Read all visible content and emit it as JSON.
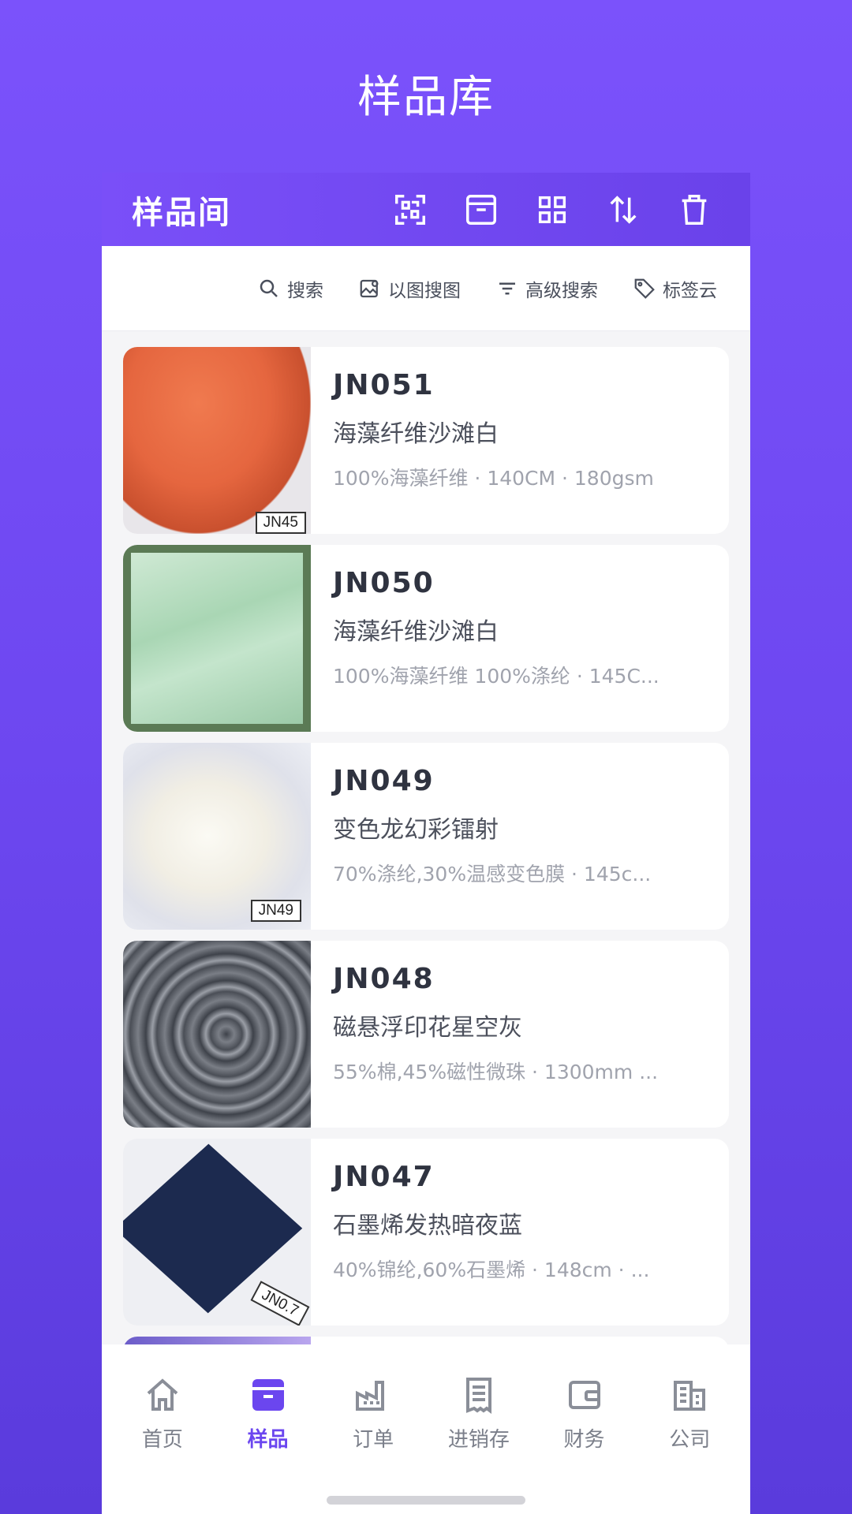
{
  "page_title": "样品库",
  "header": {
    "title": "样品间",
    "icons": [
      "qr-scan-icon",
      "archive-icon",
      "grid-view-icon",
      "sort-icon",
      "delete-icon"
    ]
  },
  "search_bar": {
    "search": "搜索",
    "image_search": "以图搜图",
    "advanced_search": "高级搜索",
    "tag_cloud": "标签云"
  },
  "samples": [
    {
      "code": "JN051",
      "name": "海藻纤维沙滩白",
      "specs": "100%海藻纤维  ·  140CM  ·  180gsm",
      "tag": "JN45",
      "color": "#e5663f"
    },
    {
      "code": "JN050",
      "name": "海藻纤维沙滩白",
      "specs": "100%海藻纤维 100%涤纶  ·  145C...",
      "tag": "",
      "color": "#b8dcc0"
    },
    {
      "code": "JN049",
      "name": "变色龙幻彩镭射",
      "specs": "70%涤纶,30%温感变色膜  ·  145c...",
      "tag": "JN49",
      "color": "#f3f1ea"
    },
    {
      "code": "JN048",
      "name": "磁悬浮印花星空灰",
      "specs": "55%棉,45%磁性微珠  ·  1300mm  ...",
      "tag": "",
      "color": "#5c6068"
    },
    {
      "code": "JN047",
      "name": "石墨烯发热暗夜蓝",
      "specs": "40%锦纶,60%石墨烯  ·  148cm  ·  ...",
      "tag": "JN0.7",
      "color": "#1c2a4f"
    }
  ],
  "tabbar": {
    "items": [
      {
        "label": "首页",
        "icon": "home-icon"
      },
      {
        "label": "样品",
        "icon": "sample-box-icon"
      },
      {
        "label": "订单",
        "icon": "factory-icon"
      },
      {
        "label": "进销存",
        "icon": "receipt-icon"
      },
      {
        "label": "财务",
        "icon": "wallet-icon"
      },
      {
        "label": "公司",
        "icon": "building-icon"
      }
    ],
    "active": "样品"
  },
  "colors": {
    "accent": "#6b46ef",
    "inactive": "#7b7f8a"
  }
}
